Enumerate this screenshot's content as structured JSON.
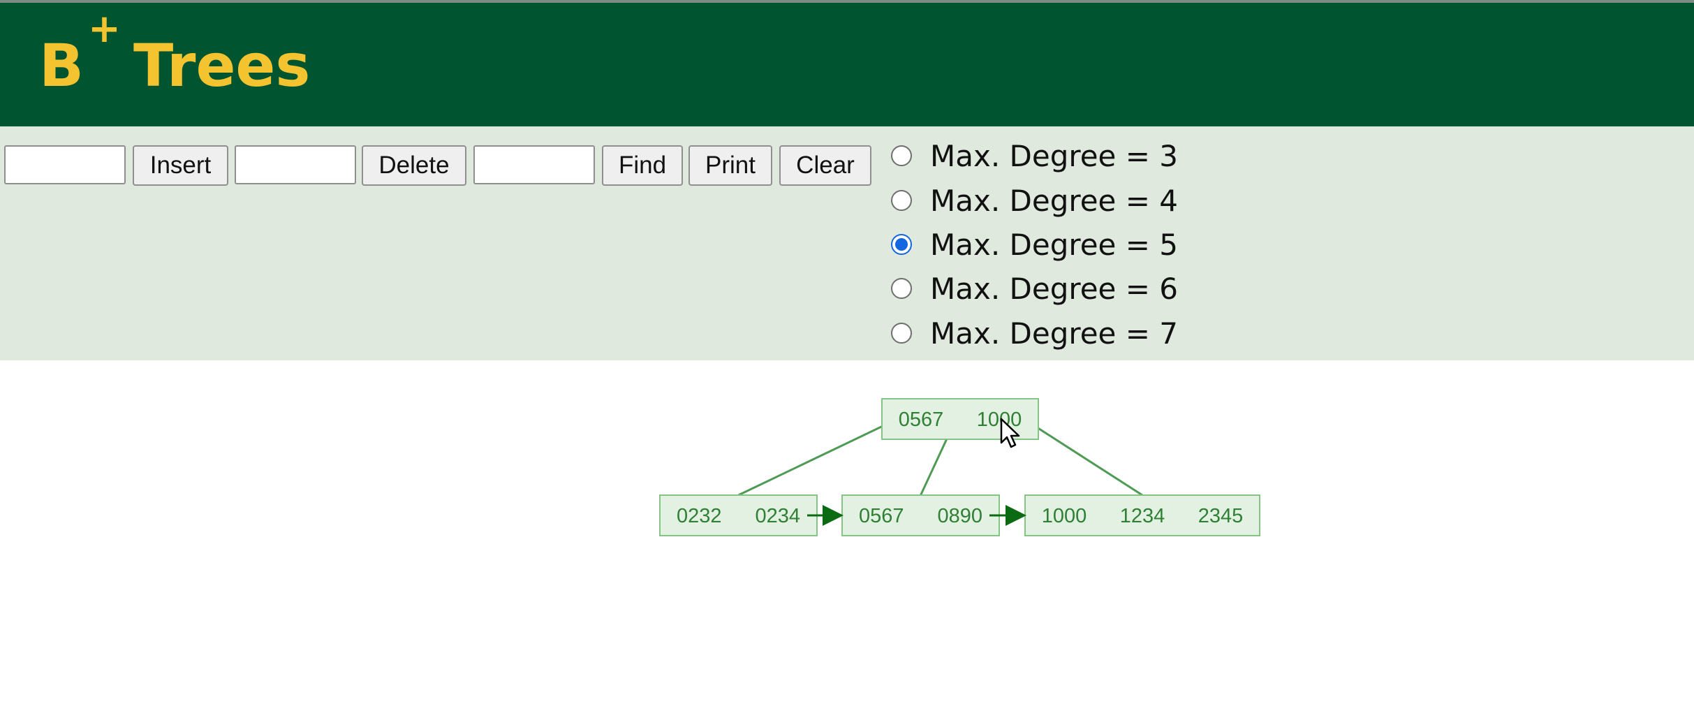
{
  "app": {
    "title": "B",
    "title_sup": "+",
    "title_rest": "Trees"
  },
  "controls": {
    "insert_value": "",
    "insert_label": "Insert",
    "delete_value": "",
    "delete_label": "Delete",
    "find_value": "",
    "find_label": "Find",
    "print_label": "Print",
    "clear_label": "Clear",
    "degree_options": [
      {
        "label": "Max. Degree = 3",
        "checked": false
      },
      {
        "label": "Max. Degree = 4",
        "checked": false
      },
      {
        "label": "Max. Degree = 5",
        "checked": true
      },
      {
        "label": "Max. Degree = 6",
        "checked": false
      },
      {
        "label": "Max. Degree = 7",
        "checked": false
      }
    ]
  },
  "tree": {
    "root": {
      "keys": [
        "0567",
        "1000"
      ]
    },
    "leaves": [
      {
        "keys": [
          "0232",
          "0234"
        ]
      },
      {
        "keys": [
          "0567",
          "0890"
        ]
      },
      {
        "keys": [
          "1000",
          "1234",
          "2345"
        ]
      }
    ]
  },
  "colors": {
    "header_bg": "#005430",
    "title": "#f3c330",
    "controls_bg": "#dfe9dd",
    "node_fill": "#e3f1e3",
    "node_stroke": "#86c486",
    "node_text": "#2f7f34",
    "edge": "#4f9a55",
    "arrow": "#0b6b12"
  }
}
